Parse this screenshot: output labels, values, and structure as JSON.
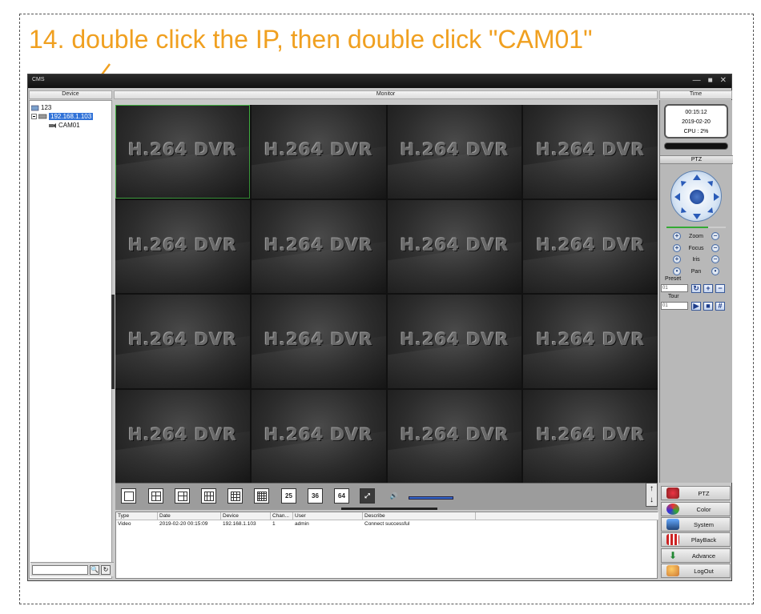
{
  "instruction": "14. double click the IP, then double click \"CAM01\"",
  "window": {
    "title": "CMS",
    "controls": [
      "—",
      "■",
      "✕"
    ]
  },
  "headers": {
    "device": "Device",
    "monitor": "Monitor",
    "time": "Time"
  },
  "tree": {
    "root": "123",
    "ip": "192.168.1.103",
    "camera": "CAM01"
  },
  "monitor": {
    "cells": [
      "H.264 DVR",
      "H.264 DVR",
      "H.264 DVR",
      "H.264 DVR",
      "H.264 DVR",
      "H.264 DVR",
      "H.264 DVR",
      "H.264 DVR",
      "H.264 DVR",
      "H.264 DVR",
      "H.264 DVR",
      "H.264 DVR",
      "H.264 DVR",
      "H.264 DVR",
      "H.264 DVR",
      "H.264 DVR"
    ]
  },
  "toolbar": {
    "layout_25": "25",
    "layout_36": "36",
    "layout_64": "64"
  },
  "log": {
    "columns": [
      "Type",
      "Date",
      "Device",
      "Chan...",
      "User",
      "Describe"
    ],
    "rows": [
      [
        "Video",
        "2019-02-20 00:15:09",
        "192.168.1.103",
        "1",
        "admin",
        "Connect successful"
      ]
    ]
  },
  "status": {
    "time": "00:15:12",
    "date": "2019-02-20",
    "cpu": "CPU : 2%"
  },
  "ptz": {
    "title": "PTZ",
    "zoom": "Zoom",
    "focus": "Focus",
    "iris": "Iris",
    "pan": "Pan",
    "preset_label": "Preset",
    "preset_value": "01",
    "tour_label": "Tour",
    "tour_value": "01"
  },
  "menu": {
    "ptz": "PTZ",
    "color": "Color",
    "system": "System",
    "playback": "PlayBack",
    "advance": "Advance",
    "logout": "LogOut"
  },
  "colors": {
    "instruction": "#f0a020",
    "selection": "#3072d8",
    "active_cell_border": "#3fae3f"
  }
}
